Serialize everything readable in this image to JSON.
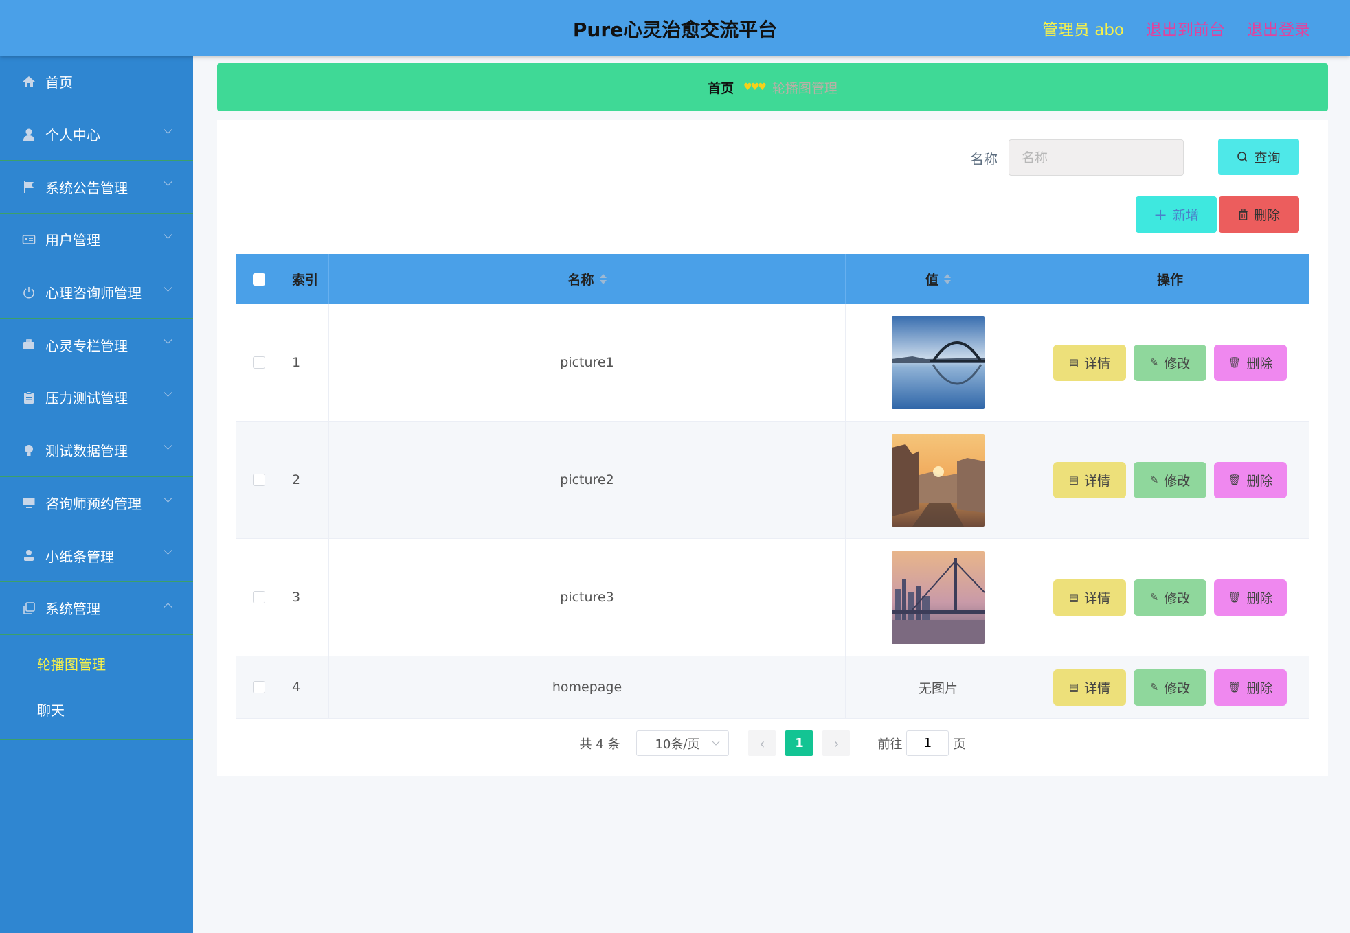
{
  "header": {
    "title": "Pure心灵治愈交流平台",
    "admin": "管理员 abo",
    "exit_front": "退出到前台",
    "logout": "退出登录"
  },
  "sidebar": {
    "items": [
      {
        "label": "首页",
        "icon": "home-icon",
        "chevron": "none"
      },
      {
        "label": "个人中心",
        "icon": "user-icon",
        "chevron": "down"
      },
      {
        "label": "系统公告管理",
        "icon": "flag-icon",
        "chevron": "down"
      },
      {
        "label": "用户管理",
        "icon": "id-card-icon",
        "chevron": "down"
      },
      {
        "label": "心理咨询师管理",
        "icon": "power-icon",
        "chevron": "down"
      },
      {
        "label": "心灵专栏管理",
        "icon": "briefcase-icon",
        "chevron": "down"
      },
      {
        "label": "压力测试管理",
        "icon": "clipboard-icon",
        "chevron": "down"
      },
      {
        "label": "测试数据管理",
        "icon": "bulb-icon",
        "chevron": "down"
      },
      {
        "label": "咨询师预约管理",
        "icon": "monitor-icon",
        "chevron": "down"
      },
      {
        "label": "小纸条管理",
        "icon": "person-icon",
        "chevron": "down"
      },
      {
        "label": "系统管理",
        "icon": "copy-icon",
        "chevron": "up"
      }
    ],
    "sub_items": [
      {
        "label": "轮播图管理",
        "active": true
      },
      {
        "label": "聊天",
        "active": false
      }
    ]
  },
  "breadcrumb": {
    "home": "首页",
    "separator": "♥♥♥",
    "current": "轮播图管理"
  },
  "search": {
    "label": "名称",
    "placeholder": "名称",
    "query_button": "查询"
  },
  "actions": {
    "add": "新增",
    "delete": "删除"
  },
  "table": {
    "headers": [
      "索引",
      "名称",
      "值",
      "操作"
    ],
    "rows": [
      {
        "index": "1",
        "name": "picture1",
        "value": "image",
        "thumb": "bridge-arch"
      },
      {
        "index": "2",
        "name": "picture2",
        "value": "image",
        "thumb": "canal-sunset"
      },
      {
        "index": "3",
        "name": "picture3",
        "value": "image",
        "thumb": "city-bridge"
      },
      {
        "index": "4",
        "name": "homepage",
        "value": "无图片",
        "thumb": "none"
      }
    ],
    "op_labels": {
      "detail": "详情",
      "edit": "修改",
      "remove": "删除"
    }
  },
  "pagination": {
    "total": "共 4 条",
    "page_size": "10条/页",
    "current_page": "1",
    "goto_label": "前往",
    "goto_value": "1",
    "page_suffix": "页"
  },
  "colors": {
    "header_bg": "#4aa0e8",
    "sidebar_bg": "#2f86d1",
    "crumb_bg": "#3fd996",
    "active_page": "#13c493"
  }
}
